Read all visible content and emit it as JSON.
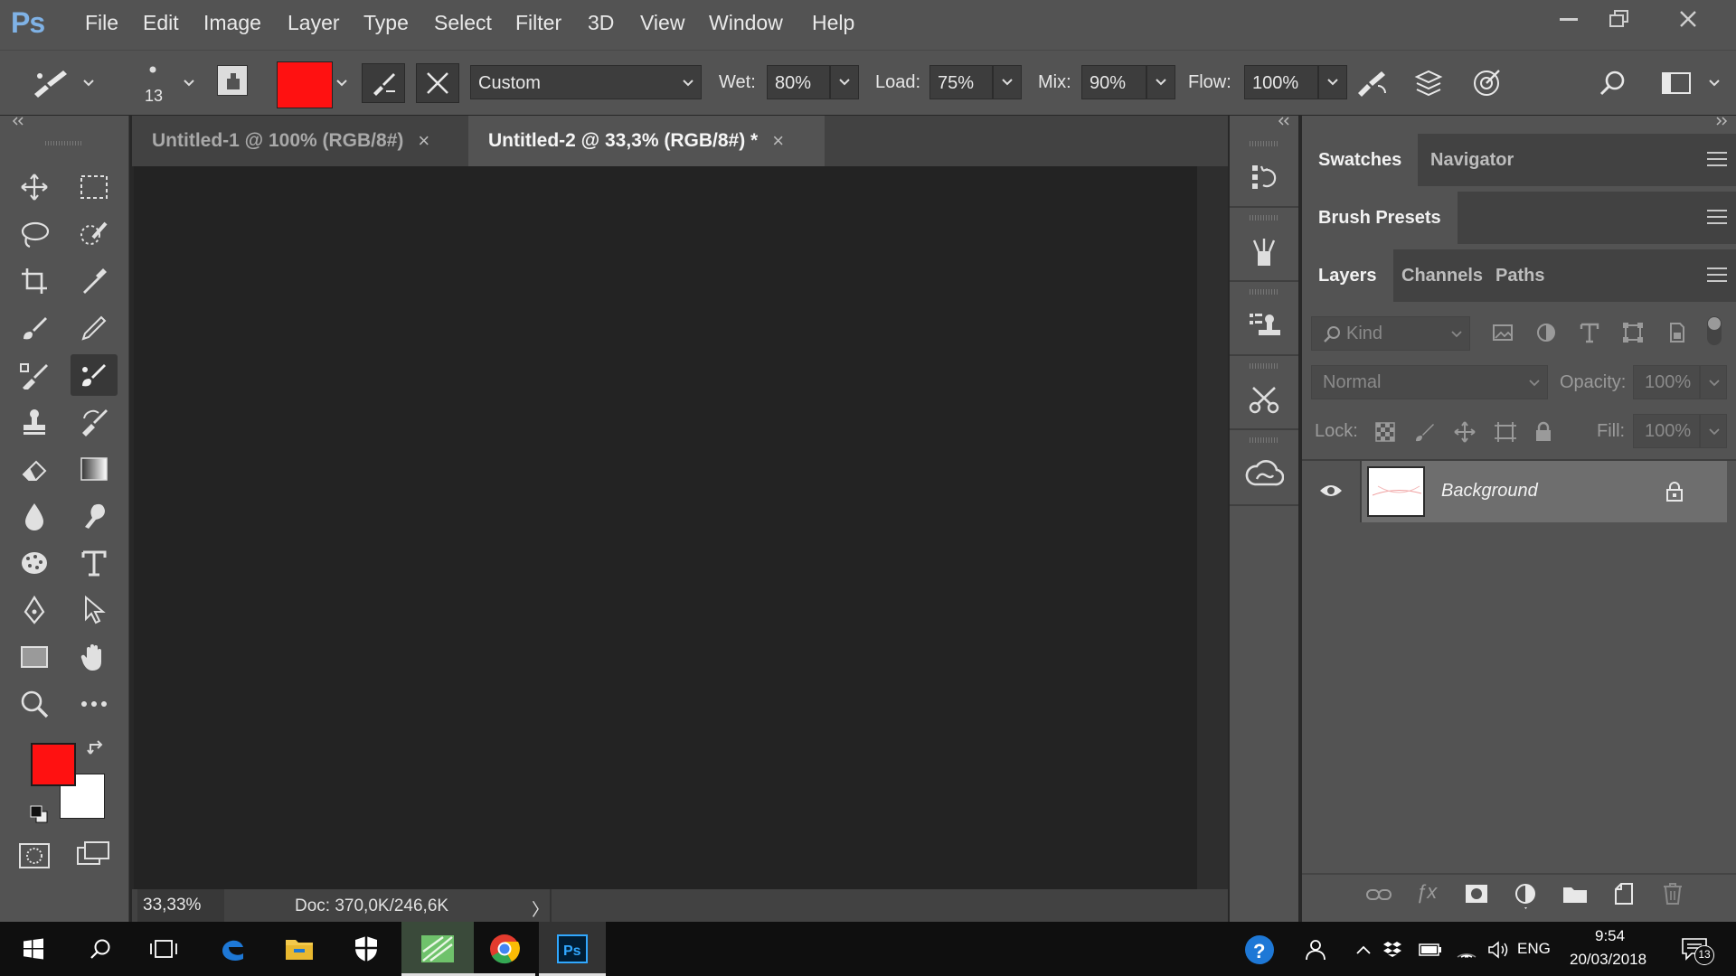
{
  "app": {
    "logo": "Ps"
  },
  "menu": [
    "File",
    "Edit",
    "Image",
    "Layer",
    "Type",
    "Select",
    "Filter",
    "3D",
    "View",
    "Window",
    "Help"
  ],
  "options": {
    "brush_size": "13",
    "brush_color": "#ff1111",
    "preset": "Custom",
    "wet_label": "Wet:",
    "wet": "80%",
    "load_label": "Load:",
    "load": "75%",
    "mix_label": "Mix:",
    "mix": "90%",
    "flow_label": "Flow:",
    "flow": "100%"
  },
  "tabs": [
    {
      "label": "Untitled-1 @ 100% (RGB/8#)",
      "close": "×"
    },
    {
      "label": "Untitled-2 @ 33,3% (RGB/8#) *",
      "close": "×"
    }
  ],
  "status": {
    "zoom": "33,33%",
    "doc": "Doc: 370,0K/246,6K",
    "arrow": "〉"
  },
  "colors": {
    "foreground": "#ff1111",
    "background": "#ffffff",
    "accent": "#535353"
  },
  "panels": {
    "row1": [
      "Swatches",
      "Navigator"
    ],
    "row2": [
      "Brush Presets"
    ],
    "row3": [
      "Layers",
      "Channels",
      "Paths"
    ]
  },
  "layers": {
    "filter_kind": "Kind",
    "blend_mode": "Normal",
    "opacity_label": "Opacity:",
    "opacity": "100%",
    "lock_label": "Lock:",
    "fill_label": "Fill:",
    "fill": "100%",
    "items": [
      {
        "name": "Background",
        "locked": true,
        "visible": true
      }
    ]
  },
  "taskbar": {
    "lang": "ENG",
    "time": "9:54",
    "date": "20/03/2018",
    "notifications": "13"
  },
  "icons": [
    "move-icon",
    "marquee-icon",
    "lasso-icon",
    "quick-select-icon",
    "crop-icon",
    "eyedropper-icon",
    "brush-icon",
    "pencil-icon",
    "healing-icon",
    "mixer-brush-icon",
    "stamp-icon",
    "history-brush-icon",
    "eraser-icon",
    "gradient-icon",
    "blur-icon",
    "smudge-icon",
    "sponge-icon",
    "type-icon",
    "pen-icon",
    "select-arrow-icon",
    "rectangle-icon",
    "hand-icon",
    "zoom-icon",
    "more-icon"
  ]
}
